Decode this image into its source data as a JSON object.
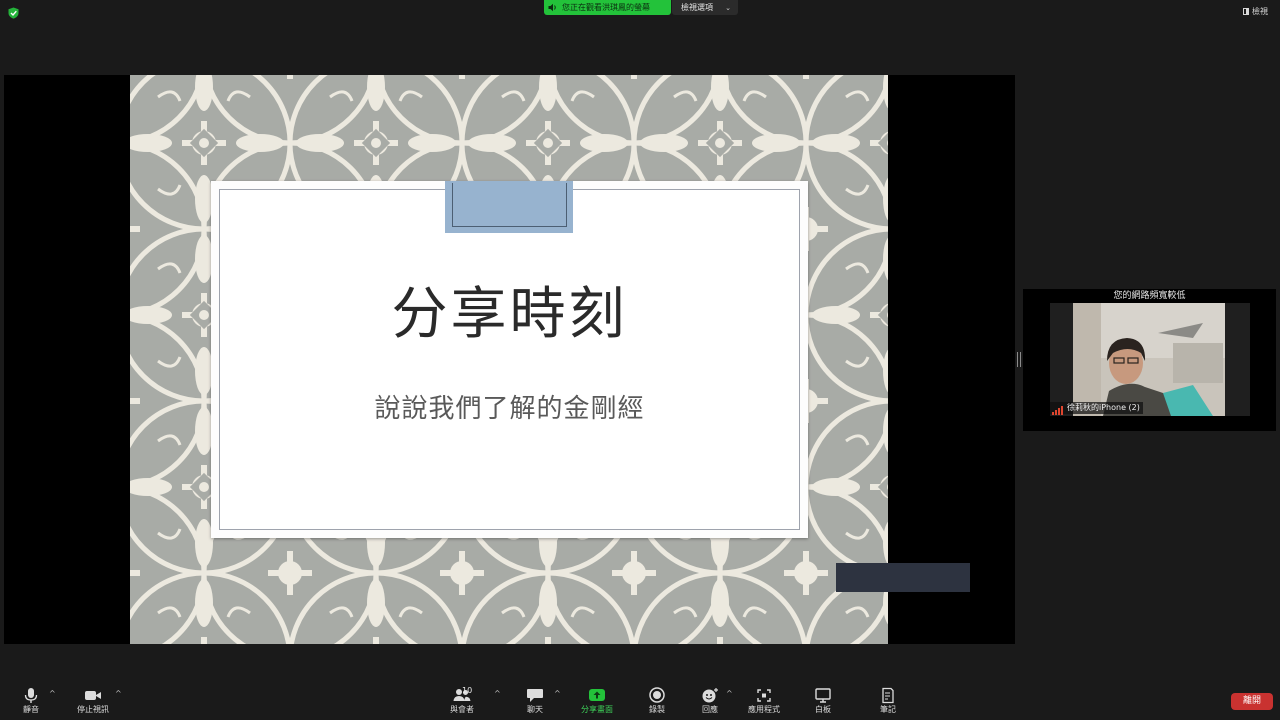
{
  "top_bar": {
    "viewing_banner": "您正在觀看洪琪鳳的螢幕",
    "view_options_label": "檢視選項",
    "view_button_label": "檢視"
  },
  "slide": {
    "title": "分享時刻",
    "subtitle": "說說我們了解的金剛經"
  },
  "participant_panel": {
    "network_warning": "您的網路頻寬較低",
    "participant_name": "徐莉秋的iPhone (2)"
  },
  "toolbar": {
    "mute_label": "靜音",
    "stop_video_label": "停止視訊",
    "participants_label": "與會者",
    "participants_count": "10",
    "chat_label": "聊天",
    "share_screen_label": "分享畫面",
    "record_label": "錄製",
    "reactions_label": "回應",
    "apps_label": "應用程式",
    "whiteboard_label": "白板",
    "notes_label": "筆記",
    "end_label": "離開"
  },
  "colors": {
    "share_green": "#23c23a",
    "end_red": "#c93230",
    "slide_tab_blue": "#97b3cf"
  },
  "icons": [
    "shield-check-icon",
    "speaker-icon",
    "chevron-down-icon",
    "grid-view-icon",
    "signal-bars-icon",
    "microphone-icon",
    "video-camera-icon",
    "participants-icon",
    "chat-bubble-icon",
    "share-screen-arrow-icon",
    "record-icon",
    "reaction-smile-icon",
    "apps-icon",
    "whiteboard-icon",
    "notes-icon"
  ]
}
